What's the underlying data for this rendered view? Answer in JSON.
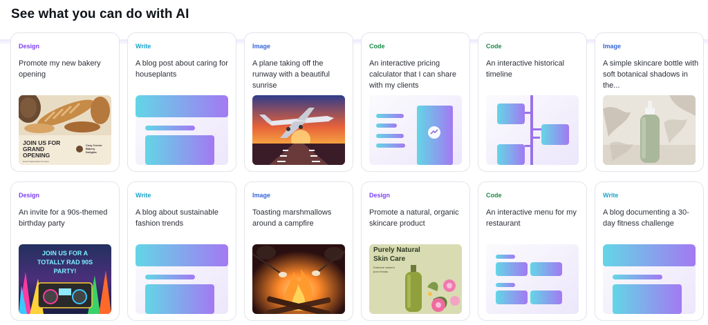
{
  "page": {
    "title": "See what you can do with AI"
  },
  "cards": [
    {
      "category": "Design",
      "description": "Promote my new bakery opening",
      "thumbnail": "bakery-poster-image",
      "thumb_text": {
        "headline": "JOIN US FOR GRAND OPENING",
        "tagline": "Good Treats Await You Here",
        "brand": "Cozy Corner Bakery Delights"
      }
    },
    {
      "category": "Write",
      "description": "A blog post about caring for houseplants",
      "thumbnail": "write-doc-illustration"
    },
    {
      "category": "Image",
      "description": "A plane taking off the runway with a beautiful sunrise",
      "thumbnail": "plane-sunrise-image"
    },
    {
      "category": "Code",
      "description": "An interactive pricing calculator that I can share with my clients",
      "thumbnail": "pricing-calculator-illustration"
    },
    {
      "category": "Code",
      "description": "An interactive historical timeline",
      "thumbnail": "timeline-illustration"
    },
    {
      "category": "Image",
      "description": "A simple skincare bottle with soft botanical shadows in the...",
      "thumbnail": "skincare-bottle-image"
    },
    {
      "category": "Design",
      "description": "An invite for a 90s-themed birthday party",
      "thumbnail": "90s-party-invite-image",
      "thumb_text": {
        "headline": "JOIN US FOR A TOTALLY RAD 90S PARTY!"
      }
    },
    {
      "category": "Write",
      "description": "A blog about sustainable fashion trends",
      "thumbnail": "write-doc-illustration"
    },
    {
      "category": "Image",
      "description": "Toasting marshmallows around a campfire",
      "thumbnail": "campfire-image"
    },
    {
      "category": "Design",
      "description": "Promote a natural, organic skincare product",
      "thumbnail": "skincare-ad-image",
      "thumb_text": {
        "headline": "Purely Natural Skin Care",
        "tagline": "Embrace nature's pure beauty"
      }
    },
    {
      "category": "Code",
      "description": "An interactive menu for my restaurant",
      "thumbnail": "restaurant-menu-illustration"
    },
    {
      "category": "Write",
      "description": "A blog documenting a 30-day fitness challenge",
      "thumbnail": "write-doc-illustration"
    }
  ],
  "colors": {
    "design": "#7b3ff2",
    "write": "#1aa3c8",
    "image": "#3565d8",
    "code": "#1b8a48",
    "gradient_start": "#63d6e6",
    "gradient_end": "#a379f2"
  }
}
